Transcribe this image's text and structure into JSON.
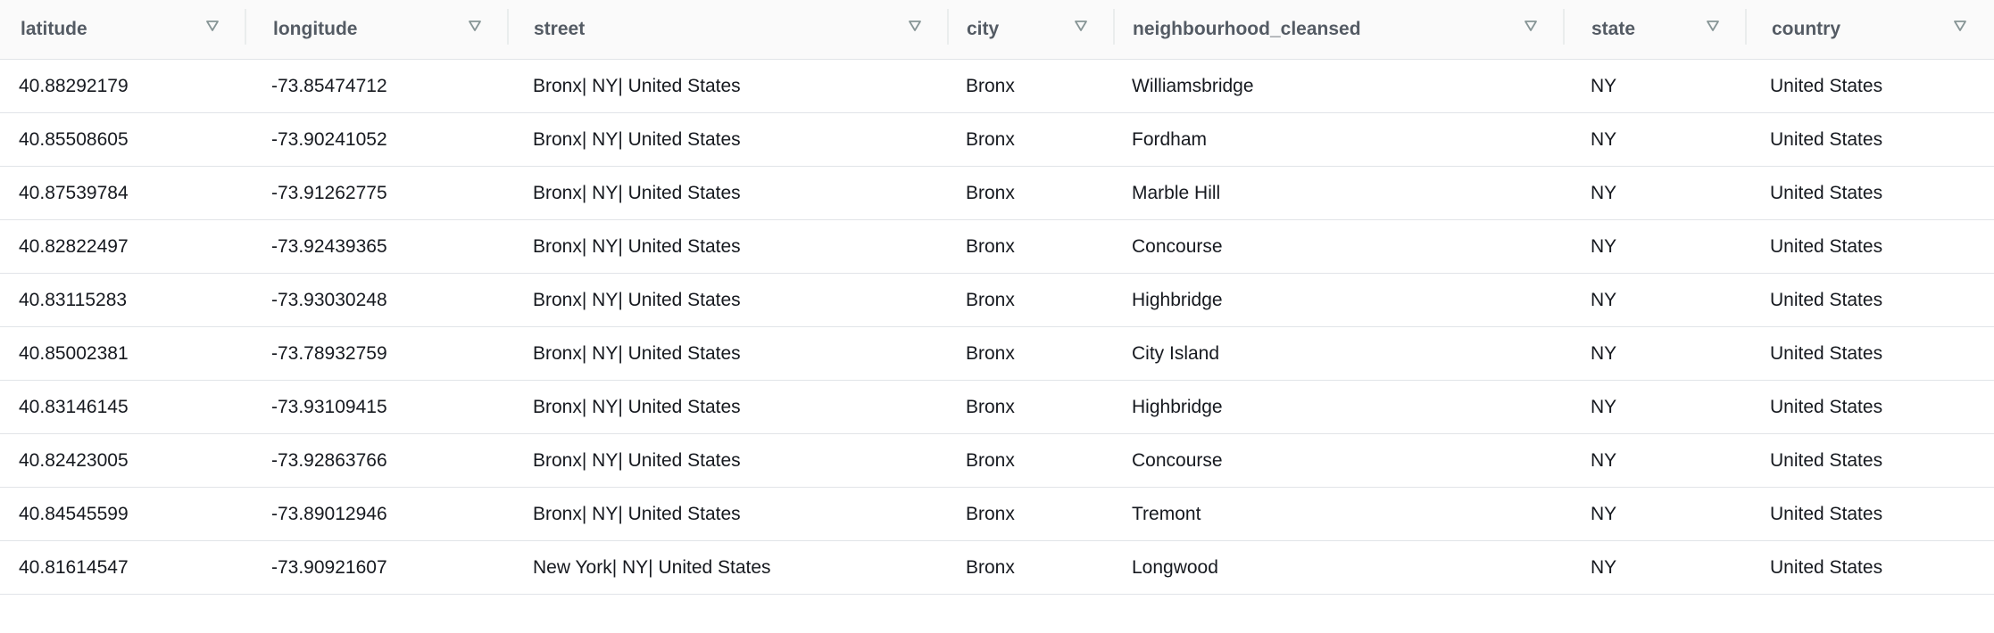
{
  "table": {
    "columns": [
      {
        "key": "latitude",
        "label": "latitude",
        "sort_icon": "sort-triangle-icon"
      },
      {
        "key": "longitude",
        "label": "longitude",
        "sort_icon": "sort-triangle-icon"
      },
      {
        "key": "street",
        "label": "street",
        "sort_icon": "sort-triangle-icon"
      },
      {
        "key": "city",
        "label": "city",
        "sort_icon": "sort-triangle-icon"
      },
      {
        "key": "neighbourhood_cleansed",
        "label": "neighbourhood_cleansed",
        "sort_icon": "sort-triangle-icon"
      },
      {
        "key": "state",
        "label": "state",
        "sort_icon": "sort-triangle-icon"
      },
      {
        "key": "country",
        "label": "country",
        "sort_icon": "sort-triangle-icon"
      }
    ],
    "rows": [
      [
        "40.88292179",
        "-73.85474712",
        "Bronx| NY| United States",
        "Bronx",
        "Williamsbridge",
        "NY",
        "United States"
      ],
      [
        "40.85508605",
        "-73.90241052",
        "Bronx| NY| United States",
        "Bronx",
        "Fordham",
        "NY",
        "United States"
      ],
      [
        "40.87539784",
        "-73.91262775",
        "Bronx| NY| United States",
        "Bronx",
        "Marble Hill",
        "NY",
        "United States"
      ],
      [
        "40.82822497",
        "-73.92439365",
        "Bronx| NY| United States",
        "Bronx",
        "Concourse",
        "NY",
        "United States"
      ],
      [
        "40.83115283",
        "-73.93030248",
        "Bronx| NY| United States",
        "Bronx",
        "Highbridge",
        "NY",
        "United States"
      ],
      [
        "40.85002381",
        "-73.78932759",
        "Bronx| NY| United States",
        "Bronx",
        "City Island",
        "NY",
        "United States"
      ],
      [
        "40.83146145",
        "-73.93109415",
        "Bronx| NY| United States",
        "Bronx",
        "Highbridge",
        "NY",
        "United States"
      ],
      [
        "40.82423005",
        "-73.92863766",
        "Bronx| NY| United States",
        "Bronx",
        "Concourse",
        "NY",
        "United States"
      ],
      [
        "40.84545599",
        "-73.89012946",
        "Bronx| NY| United States",
        "Bronx",
        "Tremont",
        "NY",
        "United States"
      ],
      [
        "40.81614547",
        "-73.90921607",
        "New York| NY| United States",
        "Bronx",
        "Longwood",
        "NY",
        "United States"
      ]
    ]
  },
  "colors": {
    "header_bg": "#fafafa",
    "header_text": "#545b64",
    "cell_text": "#16191f",
    "row_border": "#e1e4e8",
    "sort_icon": "#879596"
  }
}
